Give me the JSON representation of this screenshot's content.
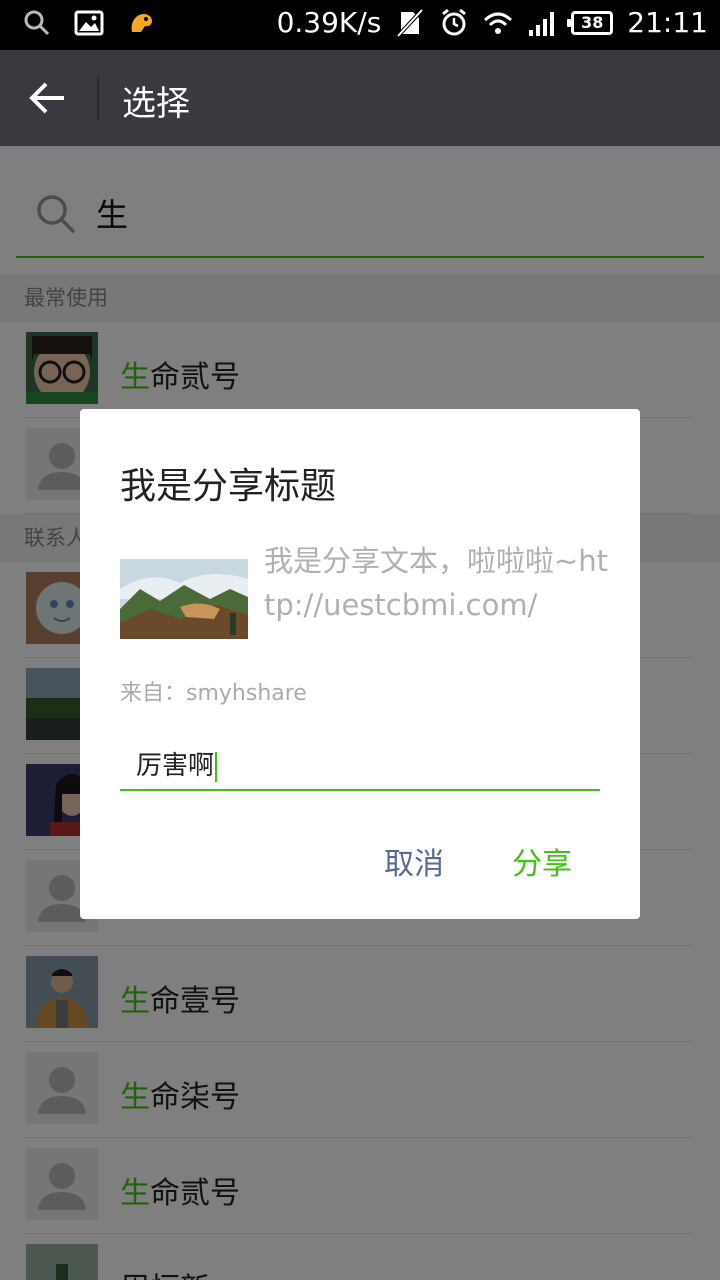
{
  "status_bar": {
    "network_speed": "0.39K/s",
    "battery_level": "38",
    "time": "21:11",
    "icons": [
      "search-icon",
      "gallery-icon",
      "uc-browser-icon",
      "no-sim-icon",
      "alarm-icon",
      "wifi-icon",
      "signal-icon"
    ]
  },
  "title_bar": {
    "title": "选择",
    "back_icon": "arrow-left-icon"
  },
  "search": {
    "query": "生",
    "icon": "search-icon"
  },
  "sections": {
    "frequent": "最常使用",
    "contacts": "联系人"
  },
  "list": {
    "highlight": "生",
    "items": [
      {
        "highlight": "生",
        "rest": "命贰号"
      },
      {
        "highlight": "",
        "rest": ""
      },
      {
        "highlight": "",
        "rest": ""
      },
      {
        "highlight": "",
        "rest": ""
      },
      {
        "highlight": "",
        "rest": ""
      },
      {
        "highlight": "",
        "rest": ""
      },
      {
        "highlight": "生",
        "rest": "命壹号"
      },
      {
        "highlight": "生",
        "rest": "命柒号"
      },
      {
        "highlight": "生",
        "rest": "命贰号"
      },
      {
        "highlight": "",
        "rest": "周恒新"
      }
    ]
  },
  "dialog": {
    "title": "我是分享标题",
    "text": "我是分享文本，啦啦啦~http://uestcbmi.com/",
    "from": "来自：smyhshare",
    "input_value": "厉害啊",
    "cancel_label": "取消",
    "share_label": "分享"
  },
  "colors": {
    "accent_green": "#45c01a",
    "cancel_blue": "#576b95",
    "titlebar": "#393a3f"
  }
}
